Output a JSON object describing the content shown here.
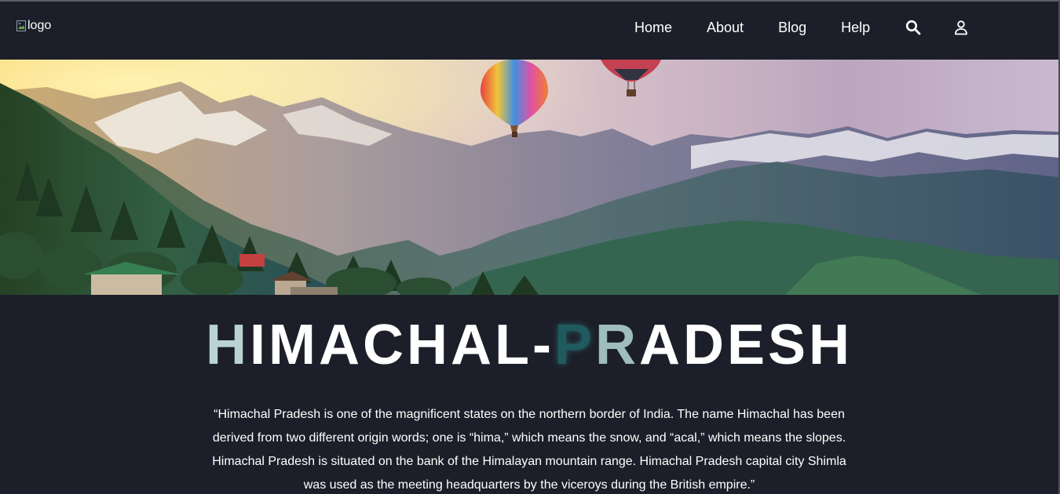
{
  "header": {
    "logo_alt": "logo",
    "nav": {
      "home": "Home",
      "about": "About",
      "blog": "Blog",
      "help": "Help"
    },
    "icons": {
      "search": "search-icon",
      "user": "user-icon"
    }
  },
  "hero": {
    "image": "mountain-valley-with-hot-air-balloons"
  },
  "title": {
    "part1": "H",
    "part2": "IMACHAL-",
    "part3": "P",
    "part4": "R",
    "part5": "ADESH"
  },
  "quote": "“Himachal Pradesh is one of the magnificent states on the northern border of India. The name Himachal has been derived from two different origin words; one is “hima,” which means the snow, and “acal,” which means the slopes. Himachal Pradesh is situated on the bank of the Himalayan mountain range. Himachal Pradesh capital city Shimla was used as the meeting headquarters by the viceroys during the British empire.”",
  "colors": {
    "background": "#1c1f29",
    "title_light": "#b9d3d3",
    "title_dark": "#1e5a5e"
  }
}
